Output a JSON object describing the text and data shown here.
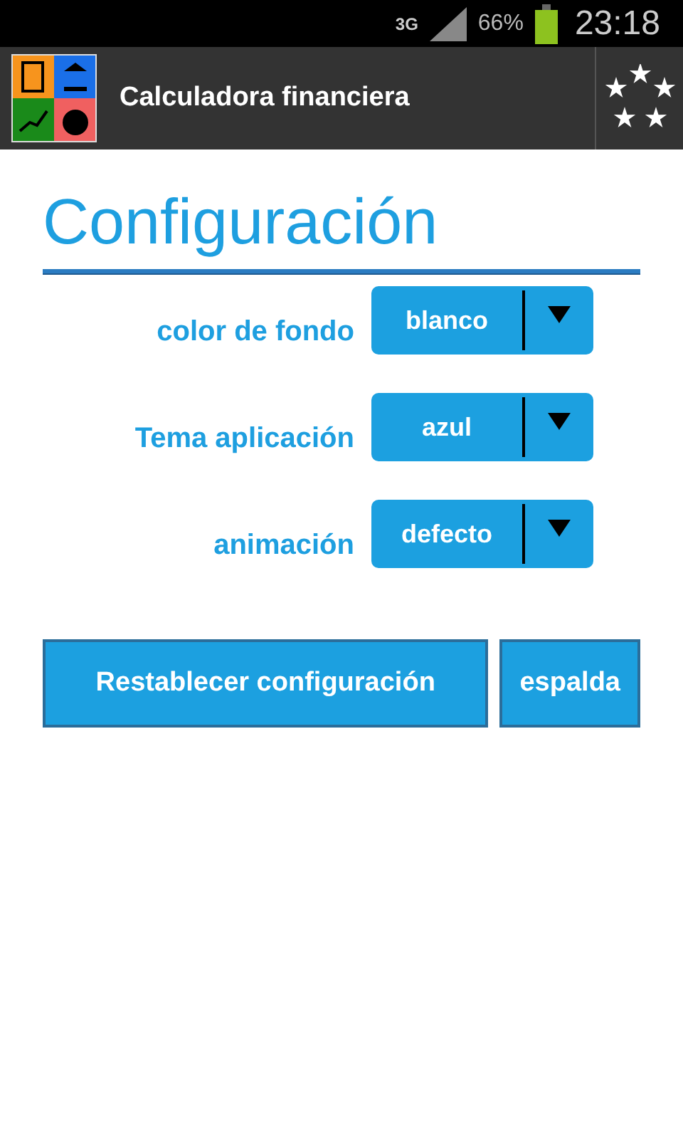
{
  "status_bar": {
    "network": "3G",
    "battery": "66%",
    "time": "23:18"
  },
  "app_bar": {
    "title": "Calculadora financiera"
  },
  "page_title": "Configuración",
  "settings": [
    {
      "label": "color de fondo",
      "value": "blanco"
    },
    {
      "label": "Tema aplicación",
      "value": "azul"
    },
    {
      "label": "animación",
      "value": "defecto"
    }
  ],
  "buttons": [
    "Restablecer configuración",
    "espalda"
  ]
}
